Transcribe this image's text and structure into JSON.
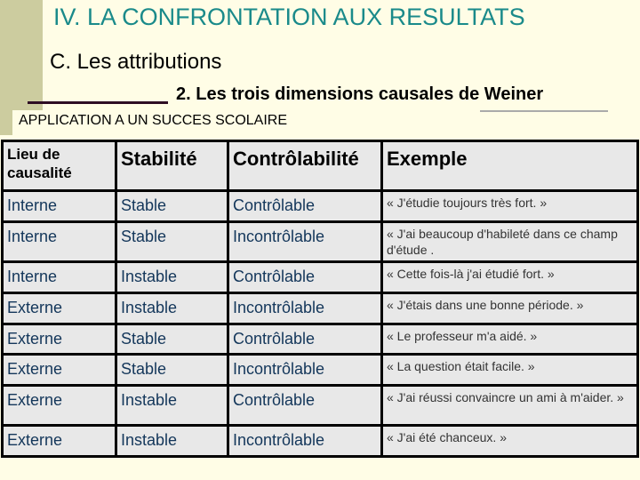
{
  "slide": {
    "title": "IV. LA CONFRONTATION AUX RESULTATS",
    "subtitle": "C. Les attributions",
    "section": "2. Les trois dimensions causales de Weiner",
    "application_label": "APPLICATION A UN SUCCES SCOLAIRE"
  },
  "table": {
    "headers": [
      "Lieu de causalité",
      "Stabilité",
      "Contrôlabilité",
      "Exemple"
    ],
    "rows": [
      {
        "lieu": "Interne",
        "stabilite": "Stable",
        "controle": "Contrôlable",
        "exemple": "« J'étudie toujours très fort. »"
      },
      {
        "lieu": "Interne",
        "stabilite": "Stable",
        "controle": "Incontrôlable",
        "exemple": "« J'ai beaucoup d'habileté dans ce champ d'étude ."
      },
      {
        "lieu": "Interne",
        "stabilite": "Instable",
        "controle": "Contrôlable",
        "exemple": "« Cette fois-là j'ai étudié fort. »"
      },
      {
        "lieu": "Externe",
        "stabilite": "Instable",
        "controle": "Incontrôlable",
        "exemple": "« J'étais dans une bonne période. »"
      },
      {
        "lieu": "Externe",
        "stabilite": "Stable",
        "controle": "Contrôlable",
        "exemple": "«  Le professeur m'a aidé. »"
      },
      {
        "lieu": "Externe",
        "stabilite": "Stable",
        "controle": "Incontrôlable",
        "exemple": "« La question était facile. »"
      },
      {
        "lieu": "Externe",
        "stabilite": "Instable",
        "controle": "Contrôlable",
        "exemple": "« J'ai réussi convaincre un ami à m'aider. »"
      },
      {
        "lieu": "Externe",
        "stabilite": "Instable",
        "controle": "Incontrôlable",
        "exemple": "« J'ai été chanceux. »"
      }
    ]
  },
  "colors": {
    "title": "#1a8a8a",
    "cell_text": "#13365a",
    "background": "#fffde6",
    "sidebar": "#cccc9f"
  }
}
